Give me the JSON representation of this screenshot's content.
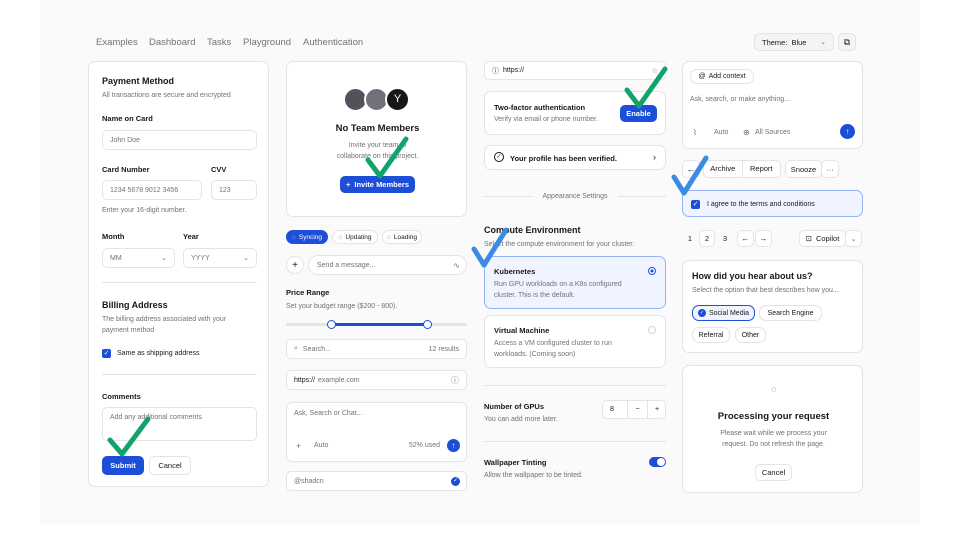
{
  "nav": {
    "items": [
      "Examples",
      "Dashboard",
      "Tasks",
      "Playground",
      "Authentication"
    ]
  },
  "theme": {
    "label": "Theme:",
    "value": "Blue"
  },
  "payment": {
    "title": "Payment Method",
    "subtitle": "All transactions are secure and encrypted",
    "name_label": "Name on Card",
    "name_placeholder": "John Doe",
    "card_label": "Card Number",
    "card_placeholder": "1234 5678 9012 3456",
    "cvv_label": "CVV",
    "cvv_placeholder": "123",
    "card_hint": "Enter your 16-digit number.",
    "month_label": "Month",
    "month_value": "MM",
    "year_label": "Year",
    "year_value": "YYYY",
    "billing_title": "Billing Address",
    "billing_sub1": "The billing address associated with your",
    "billing_sub2": "payment method",
    "same_shipping": "Same as shipping address",
    "comments_label": "Comments",
    "comments_placeholder": "Add any additional comments",
    "submit": "Submit",
    "cancel": "Cancel"
  },
  "team": {
    "title": "No Team Members",
    "sub1": "Invite your team to",
    "sub2": "collaborate on this project.",
    "invite": "Invite Members"
  },
  "status_pills": [
    "Syncing",
    "Updating",
    "Loading"
  ],
  "message": {
    "placeholder": "Send a message..."
  },
  "price": {
    "title": "Price Range",
    "sub": "Set your budget range ($200 - 800).",
    "low_pct": 25,
    "high_pct": 78
  },
  "search": {
    "placeholder": "Search...",
    "results": "12 results"
  },
  "url": {
    "prefix": "https://",
    "placeholder": "example.com"
  },
  "chat": {
    "placeholder": "Ask, Search or Chat...",
    "mode": "Auto",
    "usage": "52% used"
  },
  "mention": {
    "value": "@shadcn"
  },
  "url_bar": {
    "value": "https://"
  },
  "twofa": {
    "title": "Two-factor authentication",
    "sub": "Verify via email or phone number.",
    "enable": "Enable"
  },
  "verified": {
    "text": "Your profile has been verified."
  },
  "appearance": {
    "label": "Appearance Settings"
  },
  "compute": {
    "title": "Compute Environment",
    "sub": "Select the compute environment for your cluster.",
    "options": [
      {
        "title": "Kubernetes",
        "line1": "Run GPU workloads on a K8s configured",
        "line2": "cluster. This is the default."
      },
      {
        "title": "Virtual Machine",
        "line1": "Access a VM configured cluster to run",
        "line2": "workloads. (Coming soon)"
      }
    ]
  },
  "gpus": {
    "title": "Number of GPUs",
    "sub": "You can add more later.",
    "value": "8"
  },
  "wallpaper": {
    "title": "Wallpaper Tinting",
    "sub": "Allow the wallpaper to be tinted."
  },
  "context": {
    "add": "Add context",
    "placeholder": "Ask, search, or make anything...",
    "mode": "Auto",
    "sources": "All Sources"
  },
  "actions": {
    "archive": "Archive",
    "report": "Report",
    "snooze": "Snooze"
  },
  "terms": {
    "text": "I agree to the terms and conditions"
  },
  "pager": {
    "pages": [
      "1",
      "2",
      "3"
    ],
    "copilot": "Copilot"
  },
  "survey": {
    "title": "How did you hear about us?",
    "sub": "Select the option that best describes how you...",
    "options": [
      "Social Media",
      "Search Engine",
      "Referral",
      "Other"
    ]
  },
  "processing": {
    "title": "Processing your request",
    "sub1": "Please wait while we process your",
    "sub2": "request. Do not refresh the page.",
    "cancel": "Cancel"
  },
  "colors": {
    "accent": "#1d4ed8",
    "check_green": "#12a36b",
    "check_blue": "#3b8ae6"
  }
}
